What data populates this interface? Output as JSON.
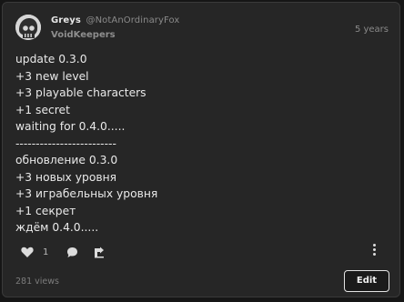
{
  "post": {
    "author": {
      "name": "Greys",
      "handle": "@NotAnOrdinaryFox"
    },
    "group": "VoidKeepers",
    "time": "5 years",
    "lines": [
      "update 0.3.0",
      "+3 new level",
      "+3 playable characters",
      "+1 secret",
      "waiting for 0.4.0.....",
      "-------------------------",
      "обновление 0.3.0",
      "+3 новых уровня",
      "+3 играбельных уровня",
      "+1 секрет",
      "ждём 0.4.0....."
    ],
    "likes": "1",
    "views": "281 views",
    "edit_label": "Edit"
  },
  "icons": {
    "avatar": "skull-avatar",
    "like": "heart-icon",
    "comment": "comment-icon",
    "share": "share-icon",
    "more": "more-vertical-icon"
  }
}
